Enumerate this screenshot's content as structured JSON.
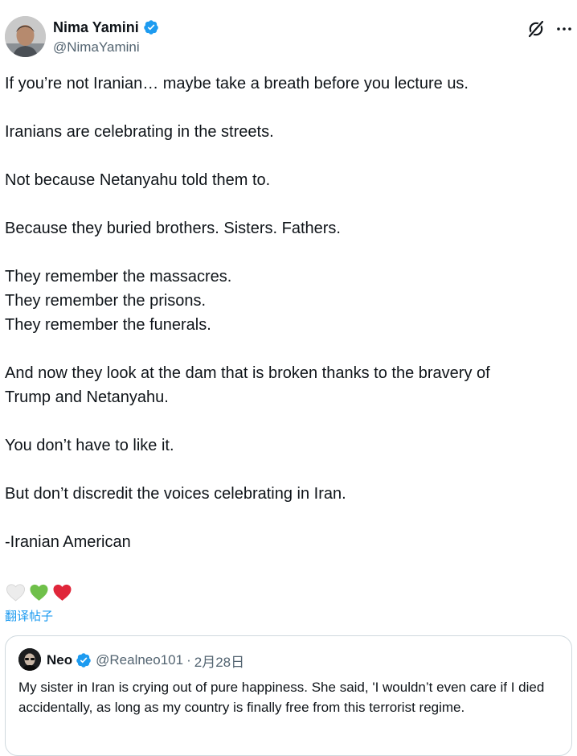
{
  "author": {
    "display_name": "Nima Yamini",
    "handle": "@NimaYamini",
    "verified": true
  },
  "actions": {
    "grok_icon": "grok-icon",
    "more_icon": "more-icon"
  },
  "tweet": {
    "paragraphs": [
      "If you’re not Iranian… maybe take a breath before you lecture us.",
      "Iranians are celebrating in the streets.",
      "Not because Netanyahu told them to.",
      "Because they buried brothers. Sisters. Fathers.",
      "They remember the massacres.\nThey remember the prisons.\nThey remember the funerals.",
      "And now they look at the dam that is broken thanks to the bravery of\nTrump and Netanyahu.",
      "You don’t have to like it.",
      "But don’t discredit the voices celebrating in Iran.",
      "-Iranian American"
    ],
    "emojis": [
      "white-heart",
      "green-heart",
      "red-heart"
    ],
    "translate_label": "翻译帖子"
  },
  "quote": {
    "display_name": "Neo",
    "verified": true,
    "handle": "@Realneo101",
    "separator": "·",
    "date": "2月28日",
    "text": "My sister in Iran is crying out of pure happiness. She said, 'I wouldn’t even care if I died accidentally, as long as my country is finally free from this terrorist regime."
  },
  "colors": {
    "verified_blue": "#1d9bf0",
    "text_primary": "#0f1419",
    "text_secondary": "#536471",
    "border": "#cfd9de"
  }
}
